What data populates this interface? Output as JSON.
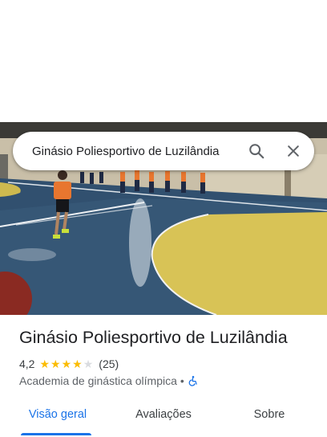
{
  "search": {
    "query": "Ginásio Poliesportivo de Luzilândia"
  },
  "icons": {
    "search": "search-icon",
    "close": "close-icon",
    "star": "star-icon",
    "accessibility": "wheelchair-icon"
  },
  "place": {
    "title": "Ginásio Poliesportivo de Luzilândia",
    "rating": "4,2",
    "rating_value": 4.2,
    "stars_filled": 4,
    "stars_total": 5,
    "review_count": "(25)",
    "category": "Academia de ginástica olímpica",
    "separator": "•"
  },
  "tabs": [
    {
      "label": "Visão geral",
      "active": true
    },
    {
      "label": "Avaliações",
      "active": false
    },
    {
      "label": "Sobre",
      "active": false
    }
  ],
  "colors": {
    "accent": "#1a73e8",
    "star": "#fbbc04",
    "court_blue": "#2e4d6b",
    "court_yellow": "#d8c356"
  }
}
